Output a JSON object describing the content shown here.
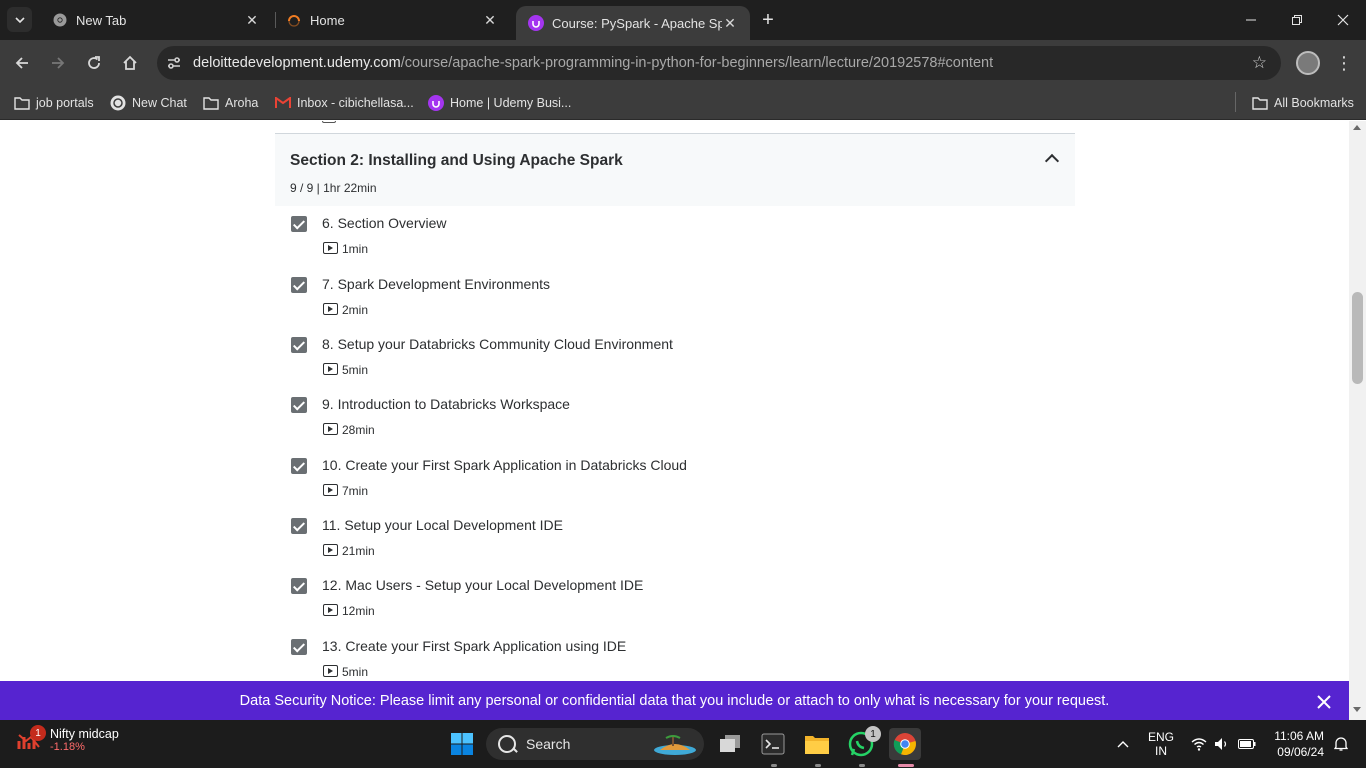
{
  "browser": {
    "tabs": [
      {
        "title": "New Tab",
        "active": false
      },
      {
        "title": "Home",
        "active": false
      },
      {
        "title": "Course: PySpark - Apache Spark",
        "active": true
      }
    ],
    "url": {
      "host": "deloittedevelopment.udemy.com",
      "path": "/course/apache-spark-programming-in-python-for-beginners/learn/lecture/20192578#content"
    },
    "bookmarks": [
      {
        "label": "job portals",
        "icon": "folder-icon"
      },
      {
        "label": "New Chat",
        "icon": "chatgpt-icon"
      },
      {
        "label": "Aroha",
        "icon": "folder-icon"
      },
      {
        "label": "Inbox - cibichellasa...",
        "icon": "gmail-icon"
      },
      {
        "label": "Home | Udemy Busi...",
        "icon": "udemy-icon"
      }
    ],
    "all_bookmarks": "All Bookmarks"
  },
  "section": {
    "title": "Section 2: Installing and Using Apache Spark",
    "meta": "9 / 9 | 1hr 22min"
  },
  "lectures": [
    {
      "title": "6. Section Overview",
      "duration": "1min"
    },
    {
      "title": "7. Spark Development Environments",
      "duration": "2min"
    },
    {
      "title": "8. Setup your Databricks Community Cloud Environment",
      "duration": "5min"
    },
    {
      "title": "9. Introduction to Databricks Workspace",
      "duration": "28min"
    },
    {
      "title": "10. Create your First Spark Application in Databricks Cloud",
      "duration": "7min"
    },
    {
      "title": "11. Setup your Local Development IDE",
      "duration": "21min"
    },
    {
      "title": "12. Mac Users - Setup your Local Development IDE",
      "duration": "12min"
    },
    {
      "title": "13. Create your First Spark Application using IDE",
      "duration": "5min"
    }
  ],
  "notice": {
    "text": "Data Security Notice: Please limit any personal or confidential data that you include or attach to only what is necessary for your request."
  },
  "taskbar": {
    "widget": {
      "name": "Nifty midcap",
      "value": "-1.18%",
      "badge": "1"
    },
    "search_label": "Search",
    "whatsapp_badge": "1",
    "lang_line1": "ENG",
    "lang_line2": "IN",
    "time": "11:06 AM",
    "date": "09/06/24"
  },
  "colors": {
    "notice_bg": "#5624d0",
    "checkbox": "#6a6f73",
    "tabbar": "#1f1f1f",
    "toolbar": "#3c3c3c"
  }
}
